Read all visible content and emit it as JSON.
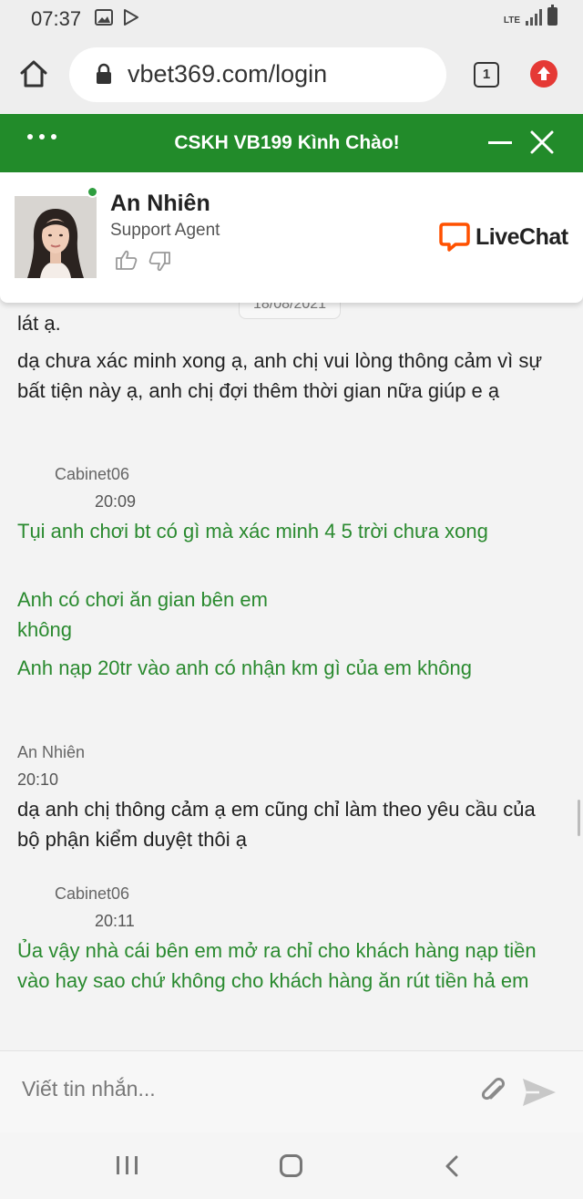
{
  "status_bar": {
    "time": "07:37",
    "network": "LTE"
  },
  "browser": {
    "url": "vbet369.com/login",
    "tab_count": "1"
  },
  "chat_header": {
    "title": "CSKH VB199 Kình Chào!"
  },
  "agent": {
    "name": "An Nhiên",
    "role": "Support Agent",
    "brand": "LiveChat",
    "online": true
  },
  "date_divider": "18/08/2021",
  "messages": [
    {
      "type": "agent",
      "text": "lát ạ."
    },
    {
      "type": "agent",
      "text": "dạ chưa xác minh xong ạ, anh chị vui lòng thông cảm vì sự bất tiện này ạ, anh chị đợi thêm thời gian nữa giúp e ạ"
    },
    {
      "type": "sender",
      "text": "Cabinet06"
    },
    {
      "type": "time",
      "text": "20:09"
    },
    {
      "type": "user",
      "text": "Tụi anh chơi bt có gì mà xác minh 4 5 trời chưa xong"
    },
    {
      "type": "user",
      "text": "Anh có chơi ăn gian bên em không"
    },
    {
      "type": "user",
      "text": "Anh nạp 20tr vào anh có nhận km gì của em không"
    },
    {
      "type": "sender",
      "text": "An Nhiên"
    },
    {
      "type": "time",
      "text": "20:10"
    },
    {
      "type": "agent",
      "text": "dạ anh chị thông cảm ạ em cũng chỉ làm theo yêu cầu của bộ phận kiểm duyệt thôi ạ"
    },
    {
      "type": "sender",
      "text": "Cabinet06"
    },
    {
      "type": "time",
      "text": "20:11"
    },
    {
      "type": "user",
      "text": "Ủa vậy nhà cái bên em mở ra chỉ cho khách hàng nạp tiền vào hay sao chứ không cho khách hàng ăn rút tiền hả em"
    }
  ],
  "input": {
    "placeholder": "Viết tin nhắn..."
  },
  "colors": {
    "brand_green": "#228b2a",
    "user_text": "#2a8a2f",
    "livechat_orange": "#ff5100",
    "upload_red": "#e53935"
  }
}
